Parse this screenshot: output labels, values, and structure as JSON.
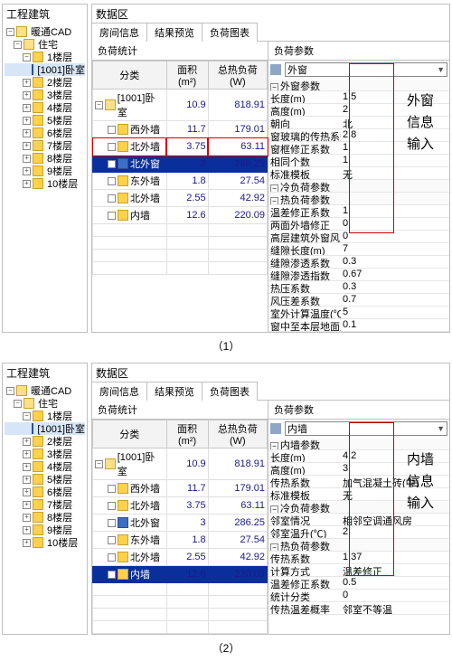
{
  "labels": {
    "project": "工程建筑",
    "data_area": "数据区",
    "tabs": [
      "房间信息",
      "结果预览",
      "负荷图表"
    ],
    "load_stats": "负荷统计",
    "load_params": "负荷参数",
    "cols": {
      "cat": "分类",
      "area": "面积(m²)",
      "load": "总热负荷(W)"
    }
  },
  "tree": {
    "root": "暖通CAD",
    "house": "住宅",
    "floors": [
      "1楼层",
      "2楼层",
      "3楼层",
      "4楼层",
      "5楼层",
      "6楼层",
      "7楼层",
      "8楼层",
      "9楼层",
      "10楼层"
    ],
    "room": "[1001]卧室"
  },
  "table1": [
    {
      "name": "[1001]卧室",
      "area": "10.9",
      "load": "818.91",
      "icon": "f"
    },
    {
      "name": "西外墙",
      "area": "11.7",
      "load": "179.01",
      "icon": "y"
    },
    {
      "name": "北外墙",
      "area": "3.75",
      "load": "63.11",
      "icon": "y",
      "red": true
    },
    {
      "name": "北外窗",
      "area": "3",
      "load": "286.25",
      "icon": "b",
      "sel": true
    },
    {
      "name": "东外墙",
      "area": "1.8",
      "load": "27.54",
      "icon": "y"
    },
    {
      "name": "北外墙",
      "area": "2.55",
      "load": "42.92",
      "icon": "y"
    },
    {
      "name": "内墙",
      "area": "12.6",
      "load": "220.09",
      "icon": "y"
    }
  ],
  "table2": [
    {
      "name": "[1001]卧室",
      "area": "10.9",
      "load": "818.91",
      "icon": "f"
    },
    {
      "name": "西外墙",
      "area": "11.7",
      "load": "179.01",
      "icon": "y"
    },
    {
      "name": "北外墙",
      "area": "3.75",
      "load": "63.11",
      "icon": "y"
    },
    {
      "name": "北外窗",
      "area": "3",
      "load": "286.25",
      "icon": "b"
    },
    {
      "name": "东外墙",
      "area": "1.8",
      "load": "27.54",
      "icon": "y"
    },
    {
      "name": "北外墙",
      "area": "2.55",
      "load": "42.92",
      "icon": "y"
    },
    {
      "name": "内墙",
      "area": "12.6",
      "load": "220.09",
      "icon": "y",
      "sel": true
    }
  ],
  "dd1": {
    "label": "外窗",
    "group": "外窗参数"
  },
  "props1": [
    {
      "k": "长度(m)",
      "v": "1.5"
    },
    {
      "k": "高度(m)",
      "v": "2"
    },
    {
      "k": "朝向",
      "v": "北"
    },
    {
      "k": "窗玻璃的传热系数",
      "v": "2.8"
    },
    {
      "k": "窗框修正系数",
      "v": "1"
    },
    {
      "k": "相同个数",
      "v": "1"
    },
    {
      "k": "标准模板",
      "v": "无"
    }
  ],
  "props1b": [
    {
      "hd": "冷负荷参数"
    },
    {
      "hd": "热负荷参数"
    },
    {
      "k": "温差修正系数",
      "v": "1"
    },
    {
      "k": "两面外墙修正",
      "v": "0"
    },
    {
      "k": "高层建筑外窗风力",
      "v": "0"
    },
    {
      "k": "缝隙长度(m)",
      "v": "7"
    },
    {
      "k": "缝隙渗透系数",
      "v": "0.3"
    },
    {
      "k": "缝隙渗透指数",
      "v": "0.67"
    },
    {
      "k": "热压系数",
      "v": "0.3"
    },
    {
      "k": "风压差系数",
      "v": "0.7"
    },
    {
      "k": "室外计算温度(℃)",
      "v": "5"
    },
    {
      "k": "窗中至本层地面距",
      "v": "0.1"
    }
  ],
  "dd2": {
    "label": "内墙",
    "group": "内墙参数"
  },
  "props2": [
    {
      "k": "长度(m)",
      "v": "4.2"
    },
    {
      "k": "高度(m)",
      "v": "3"
    },
    {
      "k": "传热系数",
      "v": "加气混凝土砖(中)"
    },
    {
      "k": "标准模板",
      "v": "无"
    }
  ],
  "props2b": [
    {
      "hd": "冷负荷参数"
    },
    {
      "k": "邻室情况",
      "v": "相邻空调通风房"
    },
    {
      "k": "邻室温升(℃)",
      "v": "2"
    },
    {
      "hd": "热负荷参数"
    },
    {
      "k": "传热系数",
      "v": "1.37"
    },
    {
      "k": "计算方式",
      "v": "温差修正"
    },
    {
      "k": "温差修正系数",
      "v": "0.5"
    },
    {
      "k": "统计分类",
      "v": "0"
    },
    {
      "k": "传热温差概率",
      "v": "邻室不等温"
    }
  ],
  "anno1": "外窗\n信息\n输入",
  "anno2": "内墙\n信息\n输入",
  "cap1": "（1）",
  "cap2": "（2）"
}
